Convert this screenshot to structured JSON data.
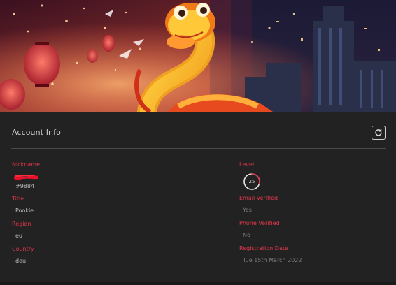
{
  "section": {
    "title": "Account Info"
  },
  "icons": {
    "refresh": "refresh-icon"
  },
  "left": {
    "nickname_label": "Nickname",
    "nickname_tag": "#9884",
    "title_label": "Title",
    "title_value": "Pookie",
    "region_label": "Region",
    "region_value": "eu",
    "country_label": "Country",
    "country_value": "deu"
  },
  "right": {
    "level_label": "Level",
    "level_value": "25",
    "level_progress": 0.3,
    "email_label": "Email Verified",
    "email_value": "Yes",
    "phone_label": "Phone Verified",
    "phone_value": "No",
    "registration_label": "Registration Date",
    "registration_value": "Tue 15th March 2022"
  },
  "colors": {
    "accent": "#e0374a",
    "panel": "#222222",
    "text": "#b9b9b9"
  }
}
